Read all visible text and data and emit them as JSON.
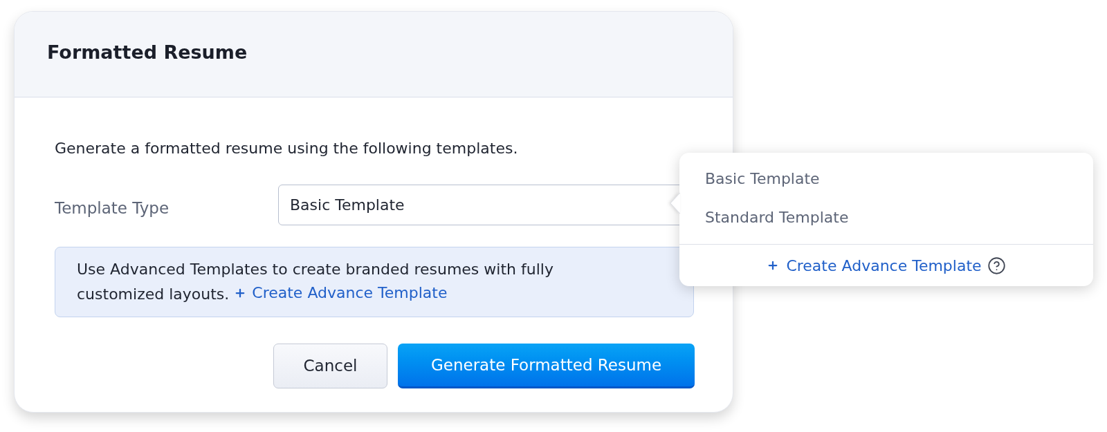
{
  "dialog": {
    "title": "Formatted Resume",
    "description": "Generate a formatted resume using the following templates.",
    "template_type": {
      "label": "Template Type",
      "value": "Basic Template"
    },
    "info": {
      "text": "Use Advanced Templates to create branded resumes with fully customized layouts.",
      "link": "Create Advance Template"
    },
    "buttons": [
      {
        "label": "Cancel",
        "kind": "secondary"
      },
      {
        "label": "Generate Formatted Resume",
        "kind": "primary"
      }
    ]
  },
  "dropdown": {
    "options": [
      "Basic Template",
      "Standard Template"
    ],
    "footer_link": "Create Advance Template"
  }
}
